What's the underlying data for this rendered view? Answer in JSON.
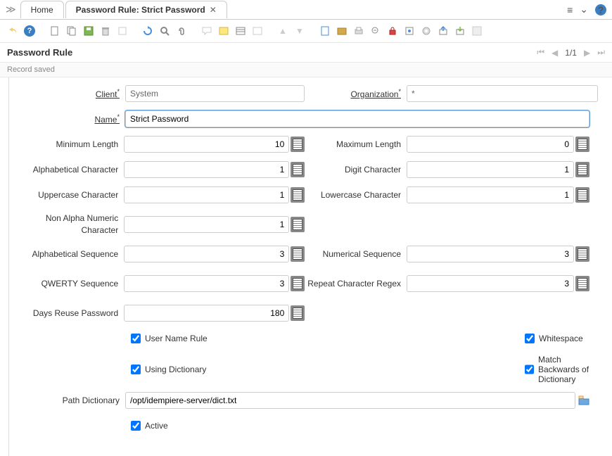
{
  "tabs": {
    "home": "Home",
    "active": "Password Rule: Strict Password"
  },
  "header": {
    "title": "Password Rule",
    "page": "1/1"
  },
  "status": "Record saved",
  "labels": {
    "client": "Client",
    "org": "Organization",
    "name": "Name",
    "minlen": "Minimum Length",
    "maxlen": "Maximum Length",
    "alpha": "Alphabetical Character",
    "digit": "Digit Character",
    "upper": "Uppercase Character",
    "lower": "Lowercase Character",
    "nonalpha": "Non Alpha Numeric Character",
    "alphaseq": "Alphabetical Sequence",
    "numseq": "Numerical Sequence",
    "qwerty": "QWERTY Sequence",
    "repeat": "Repeat Character Regex",
    "reuse": "Days Reuse Password",
    "userrule": "User Name Rule",
    "whitespace": "Whitespace",
    "dict": "Using Dictionary",
    "matchback": "Match Backwards of Dictionary",
    "pathdict": "Path Dictionary",
    "active": "Active"
  },
  "values": {
    "client": "System",
    "org": "*",
    "name": "Strict Password",
    "minlen": "10",
    "maxlen": "0",
    "alpha": "1",
    "digit": "1",
    "upper": "1",
    "lower": "1",
    "nonalpha": "1",
    "alphaseq": "3",
    "numseq": "3",
    "qwerty": "3",
    "repeat": "3",
    "reuse": "180",
    "pathdict": "/opt/idempiere-server/dict.txt"
  }
}
